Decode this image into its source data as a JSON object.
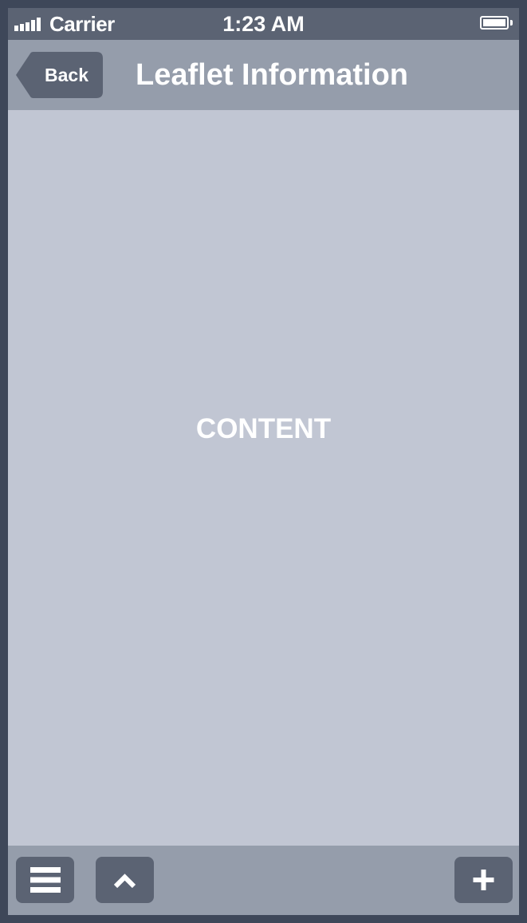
{
  "status_bar": {
    "carrier": "Carrier",
    "time": "1:23 AM"
  },
  "nav_bar": {
    "back_label": "Back",
    "title": "Leaflet Information"
  },
  "content": {
    "label": "CONTENT"
  },
  "toolbar": {
    "buttons": [
      {
        "icon": "menu-icon"
      },
      {
        "icon": "chevron-up-icon"
      },
      {
        "icon": "plus-icon"
      }
    ]
  },
  "colors": {
    "frame": "#3e4759",
    "status_bar": "#5b6373",
    "bars": "#959dab",
    "content_bg": "#c1c6d3",
    "button_bg": "#5b6373",
    "text": "#ffffff"
  }
}
